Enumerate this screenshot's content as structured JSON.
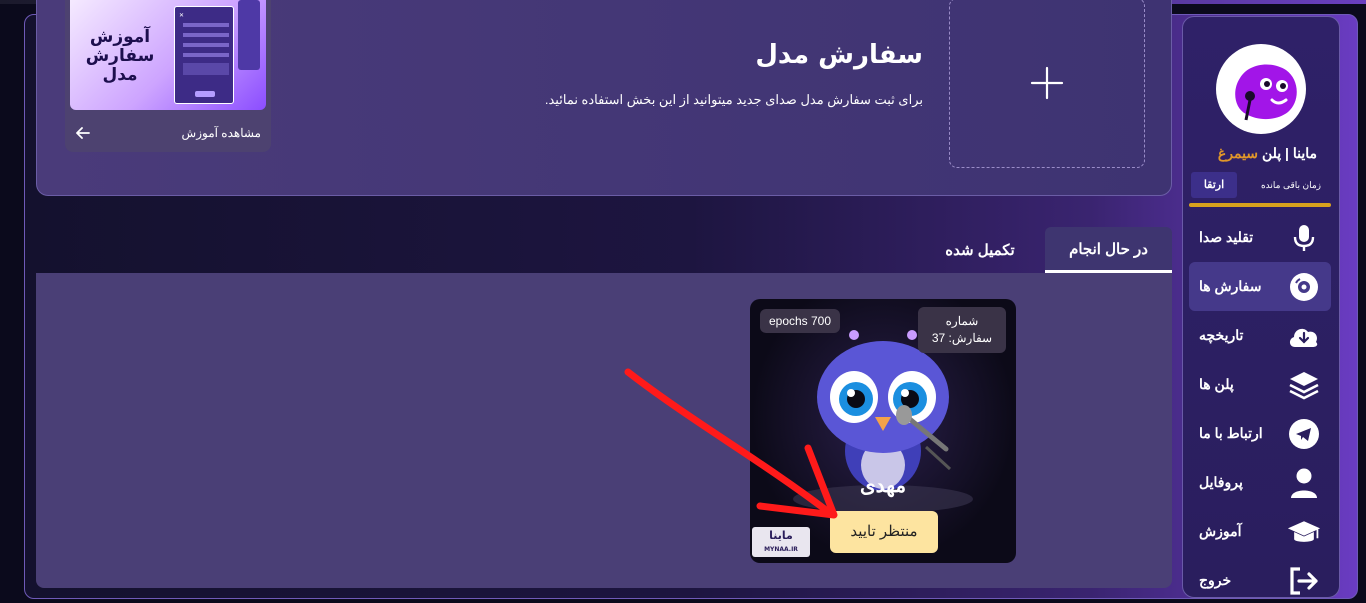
{
  "sidebar": {
    "user_name": "ماینا",
    "separator": "|",
    "plan_prefix": "پلن",
    "plan_name": "سیمرغ",
    "time_remaining_label": "زمان باقی مانده",
    "upgrade_label": "ارتقا",
    "items": [
      {
        "label": "تقلید صدا",
        "icon": "microphone-icon"
      },
      {
        "label": "سفارش ها",
        "icon": "disc-icon",
        "active": true
      },
      {
        "label": "تاریخچه",
        "icon": "cloud-download-icon"
      },
      {
        "label": "پلن ها",
        "icon": "layers-icon"
      },
      {
        "label": "ارتباط با ما",
        "icon": "telegram-icon"
      },
      {
        "label": "پروفایل",
        "icon": "user-icon"
      },
      {
        "label": "آموزش",
        "icon": "graduation-cap-icon"
      },
      {
        "label": "خروج",
        "icon": "logout-icon"
      }
    ]
  },
  "header": {
    "title": "سفارش مدل",
    "description": "برای ثبت سفارش مدل صدای جدید میتوانید از این بخش استفاده نمائید.",
    "tutorial": {
      "thumb_title": "آموزش سفارش مدل",
      "link_label": "مشاهده آموزش"
    }
  },
  "tabs": [
    {
      "label": "در حال انجام",
      "active": true
    },
    {
      "label": "تکمیل شده",
      "active": false
    }
  ],
  "order": {
    "epochs": "epochs 700",
    "order_label": "شماره",
    "order_number": "سفارش: 37",
    "model_name": "مهدی",
    "status": "منتظر تایید",
    "watermark": "ماینا",
    "watermark_sub": "MYNAA.IR"
  },
  "colors": {
    "accent_gold": "#d8a21e",
    "plan_color": "#e0962a",
    "status_bg": "#fde4a0",
    "annotation_red": "#ff1a1a"
  }
}
